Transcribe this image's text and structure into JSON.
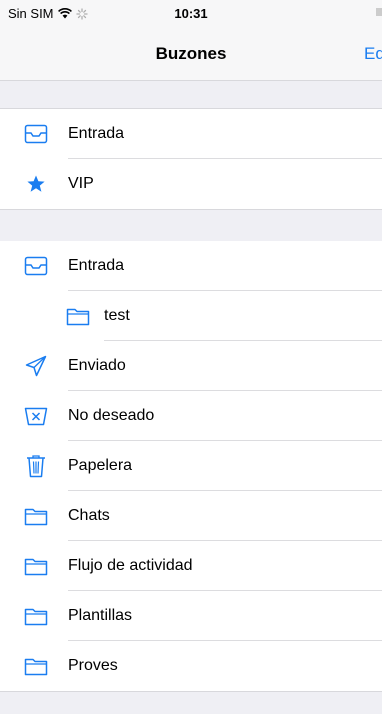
{
  "status_bar": {
    "carrier": "Sin SIM",
    "time": "10:31"
  },
  "nav": {
    "title": "Buzones",
    "edit_label": "Editar"
  },
  "section1": {
    "items": [
      {
        "label": "Entrada",
        "icon": "inbox-tray-icon"
      },
      {
        "label": "VIP",
        "icon": "star-icon"
      }
    ]
  },
  "section2": {
    "items": [
      {
        "label": "Entrada",
        "icon": "inbox-tray-icon"
      },
      {
        "label": "test",
        "icon": "folder-icon"
      },
      {
        "label": "Enviado",
        "icon": "paper-plane-icon"
      },
      {
        "label": "No deseado",
        "icon": "junk-icon"
      },
      {
        "label": "Papelera",
        "icon": "trash-icon"
      },
      {
        "label": "Chats",
        "icon": "folder-icon"
      },
      {
        "label": "Flujo de actividad",
        "icon": "folder-icon"
      },
      {
        "label": "Plantillas",
        "icon": "folder-icon"
      },
      {
        "label": "Proves",
        "icon": "folder-icon"
      }
    ]
  },
  "colors": {
    "accent": "#1a7df0",
    "background_gap": "#efeff4",
    "separator": "#dcdcdf"
  }
}
